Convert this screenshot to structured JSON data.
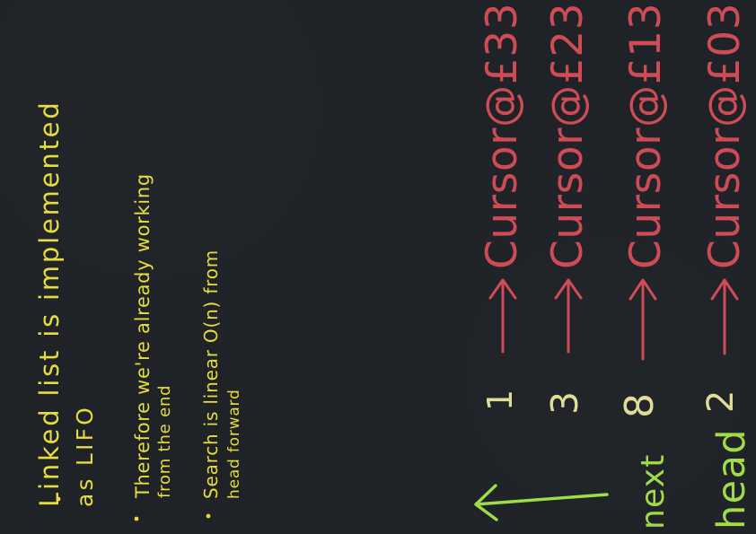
{
  "colors": {
    "background": "#1f2227",
    "notes": "#e6dc3d",
    "cursor": "#cf4c57",
    "values": "#e2dc9a",
    "labels": "#9fdc45"
  },
  "notes": [
    {
      "line1": "Linked list is implemented",
      "line2": "as LIFO"
    },
    {
      "line1": "Therefore we're already working",
      "line2": "from the end"
    },
    {
      "line1": "Search is linear O(n) from",
      "line2": "head forward"
    }
  ],
  "stack": [
    {
      "value": "1",
      "cursor": "Cursor@£33"
    },
    {
      "value": "3",
      "cursor": "Cursor@£23"
    },
    {
      "value": "8",
      "cursor": "Cursor@£13"
    },
    {
      "value": "2",
      "cursor": "Cursor@£03"
    }
  ],
  "labels": {
    "next": "next",
    "head": "head"
  }
}
